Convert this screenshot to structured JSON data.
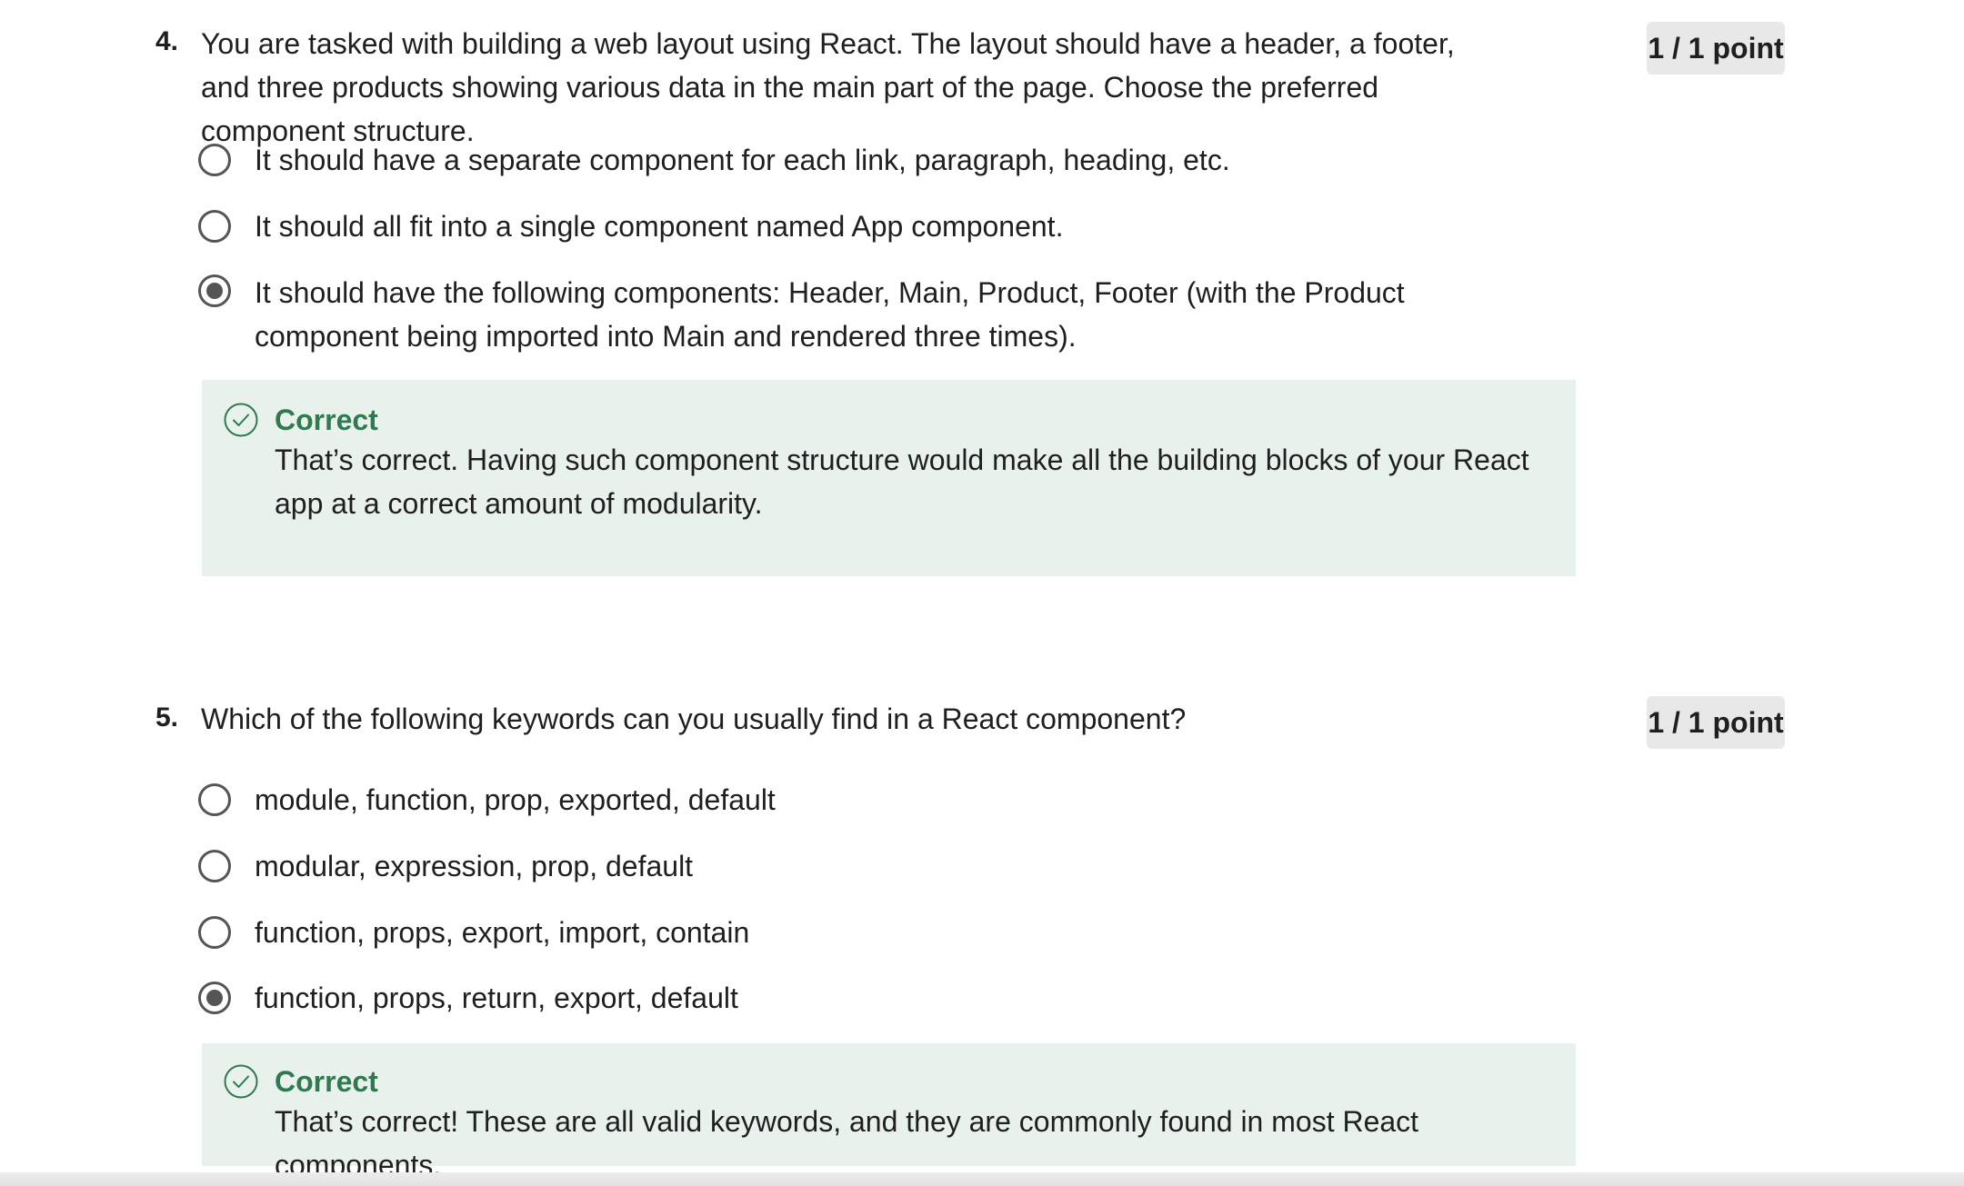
{
  "questions": [
    {
      "number": "4.",
      "prompt": "You are tasked with building a web layout using React. The layout should have a header, a footer, and three products showing various data in the main part of the page. Choose the preferred component structure.",
      "points": "1 / 1 point",
      "options": [
        {
          "label": "It should have a separate component for each link, paragraph, heading, etc.",
          "selected": false
        },
        {
          "label": "It should all fit into a single component named App component.",
          "selected": false
        },
        {
          "label": "It should have the following components: Header, Main, Product, Footer (with the Product component being imported into Main and rendered three times).",
          "selected": true
        }
      ],
      "feedback": {
        "status": "Correct",
        "text": "That’s correct. Having such component structure would make all the building blocks of your React app at a correct amount of modularity."
      }
    },
    {
      "number": "5.",
      "prompt": "Which of the following keywords can you usually find in a React component?",
      "points": "1 / 1 point",
      "options": [
        {
          "label": "module, function, prop, exported, default",
          "selected": false
        },
        {
          "label": "modular, expression, prop, default",
          "selected": false
        },
        {
          "label": "function, props, export, import, contain",
          "selected": false
        },
        {
          "label": "function, props, return, export, default",
          "selected": true
        }
      ],
      "feedback": {
        "status": "Correct",
        "text": "That’s correct! These are all valid keywords, and they are commonly found in most React components."
      }
    }
  ],
  "colors": {
    "correct": "#2f7a4f",
    "feedback_bg": "#e9f1ec",
    "badge_bg": "#e8e8e8"
  },
  "icons": {
    "feedback": "check-circle-icon",
    "radio": "radio-button"
  }
}
